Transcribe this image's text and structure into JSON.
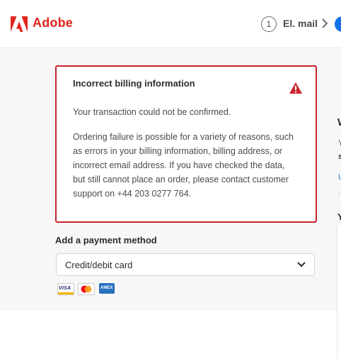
{
  "header": {
    "brand": "Adobe",
    "step_number": "1",
    "step_label": "El. mail"
  },
  "error": {
    "title": "Incorrect billing information",
    "line1": "Your transaction could not be confirmed.",
    "line2": "Ordering failure is possible for a variety of reasons, such as errors in your billing information, billing address, or incorrect email address. If you have checked the data, but still cannot place an order, please contact customer support on +44 203 0277 764."
  },
  "payment": {
    "title": "Add a payment method",
    "selected": "Credit/debit card",
    "cards": [
      "VISA",
      "Mastercard",
      "AMEX"
    ]
  },
  "side": {
    "heading_fragment": "W",
    "text_fragment": "Y",
    "bold_fragment": "s",
    "link_fragment": "U",
    "heading2_fragment": "Y"
  },
  "colors": {
    "brand": "#e1251b",
    "error_border": "#c9252c",
    "accent": "#1473e6"
  }
}
